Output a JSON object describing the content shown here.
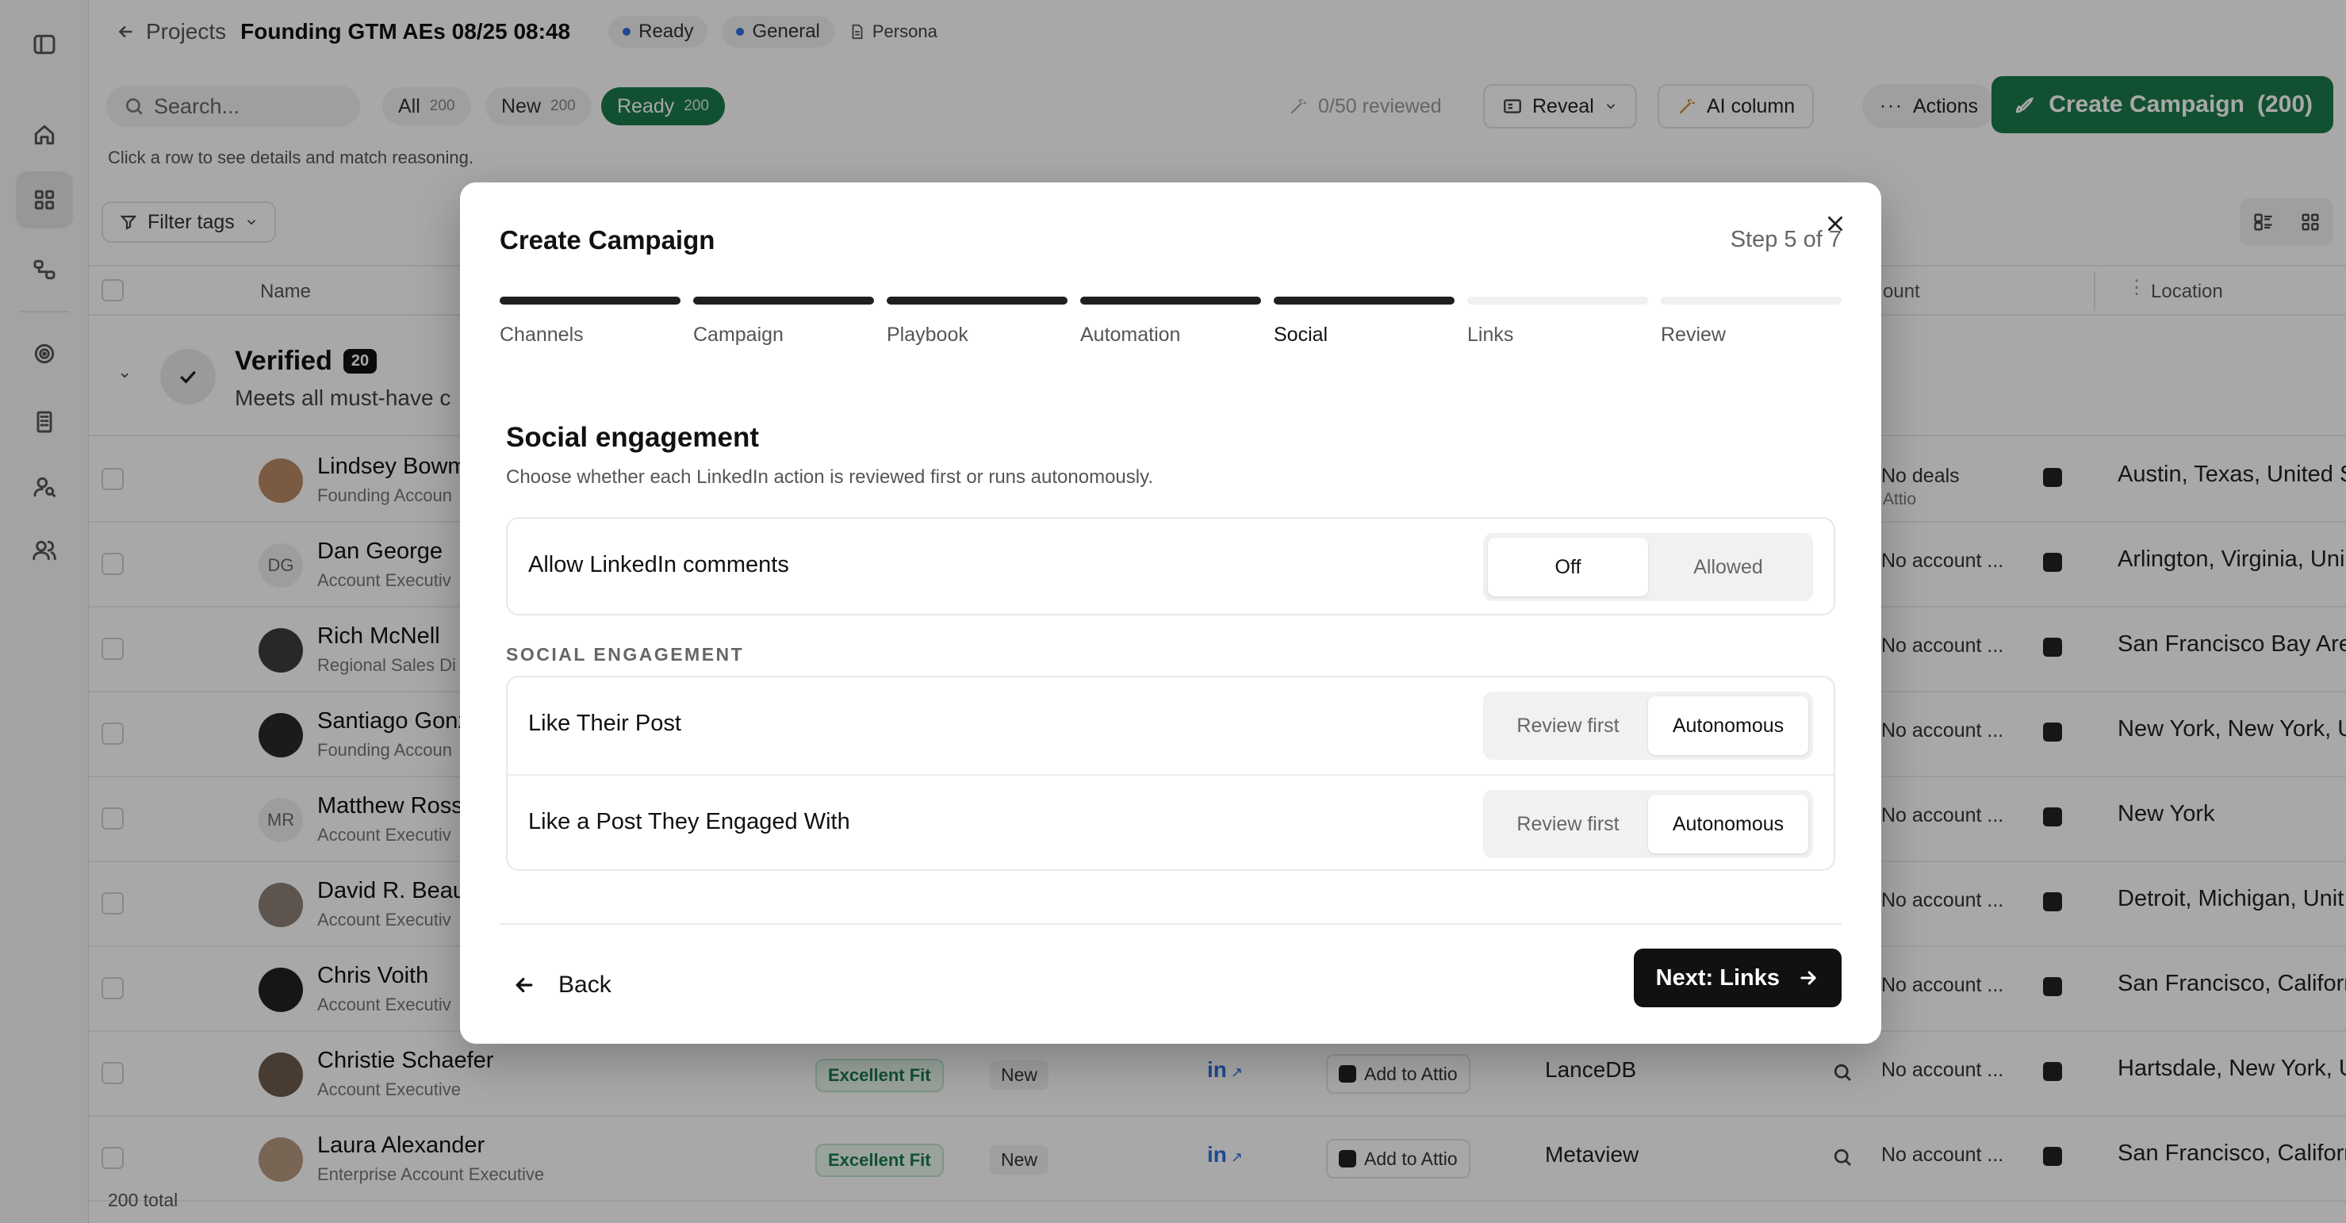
{
  "app": {
    "breadcrumb": "Projects",
    "project_title": "Founding GTM AEs 08/25 08:48",
    "status_pill": "Ready",
    "category_pill": "General",
    "persona_label": "Persona"
  },
  "toolbar": {
    "search_placeholder": "Search...",
    "filters": [
      {
        "label": "All",
        "count": "200"
      },
      {
        "label": "New",
        "count": "200"
      },
      {
        "label": "Ready",
        "count": "200"
      }
    ],
    "reviewed": "0/50 reviewed",
    "reveal": "Reveal",
    "ai_column": "AI column",
    "actions": "Actions",
    "create_campaign": "Create Campaign",
    "create_campaign_count": "(200)"
  },
  "hint": "Click a row to see details and match reasoning.",
  "filter_tags": "Filter tags",
  "table": {
    "columns": {
      "name": "Name",
      "account": "ount",
      "location": "Location"
    },
    "group": {
      "title": "Verified",
      "count": "20",
      "subtitle": "Meets all must-have c"
    },
    "rows": [
      {
        "name": "Lindsey Bowm",
        "title": "Founding Accoun",
        "initials": "",
        "account": "No deals",
        "account_sub": "Attio",
        "location": "Austin, Texas, United S"
      },
      {
        "name": "Dan George",
        "title": "Account Executiv",
        "initials": "DG",
        "account": "No account ...",
        "location": "Arlington, Virginia, Uni"
      },
      {
        "name": "Rich McNell",
        "title": "Regional Sales Di",
        "initials": "",
        "account": "No account ...",
        "location": "San Francisco Bay Are"
      },
      {
        "name": "Santiago Gonz",
        "title": "Founding Accoun",
        "initials": "",
        "account": "No account ...",
        "location": "New York, New York, U"
      },
      {
        "name": "Matthew Ross",
        "title": "Account Executiv",
        "initials": "MR",
        "account": "No account ...",
        "location": "New York"
      },
      {
        "name": "David R. Beau",
        "title": "Account Executiv",
        "initials": "",
        "account": "No account ...",
        "location": "Detroit, Michigan, Unit"
      },
      {
        "name": "Chris Voith",
        "title": "Account Executiv",
        "initials": "",
        "account": "No account ...",
        "location": "San Francisco, Califorr"
      },
      {
        "name": "Christie Schaefer",
        "title": "Account Executive",
        "initials": "",
        "fit": "Excellent Fit",
        "status": "New",
        "linkedin": "in",
        "attio": "Add to Attio",
        "company": "LanceDB",
        "account": "No account ...",
        "location": "Hartsdale, New York, U"
      },
      {
        "name": "Laura Alexander",
        "title": "Enterprise Account Executive",
        "initials": "",
        "fit": "Excellent Fit",
        "status": "New",
        "linkedin": "in",
        "attio": "Add to Attio",
        "company": "Metaview",
        "account": "No account ...",
        "location": "San Francisco, Califorr"
      }
    ],
    "total": "200 total"
  },
  "modal": {
    "title": "Create Campaign",
    "step_counter": "Step 5 of 7",
    "current_step": 5,
    "steps": [
      "Channels",
      "Campaign",
      "Playbook",
      "Automation",
      "Social",
      "Links",
      "Review"
    ],
    "section_title": "Social engagement",
    "section_desc": "Choose whether each LinkedIn action is reviewed first or runs autonomously.",
    "comments": {
      "label": "Allow LinkedIn comments",
      "options": [
        "Off",
        "Allowed"
      ],
      "selected": "Off"
    },
    "group_label": "SOCIAL ENGAGEMENT",
    "actions": [
      {
        "label": "Like Their Post",
        "options": [
          "Review first",
          "Autonomous"
        ],
        "selected": "Autonomous"
      },
      {
        "label": "Like a Post They Engaged With",
        "options": [
          "Review first",
          "Autonomous"
        ],
        "selected": "Autonomous"
      }
    ],
    "back": "Back",
    "next": "Next: Links"
  },
  "colors": {
    "accent_green": "#1a7a4a",
    "primary_dark": "#111111",
    "overlay": "rgba(0,0,0,0.34)"
  }
}
